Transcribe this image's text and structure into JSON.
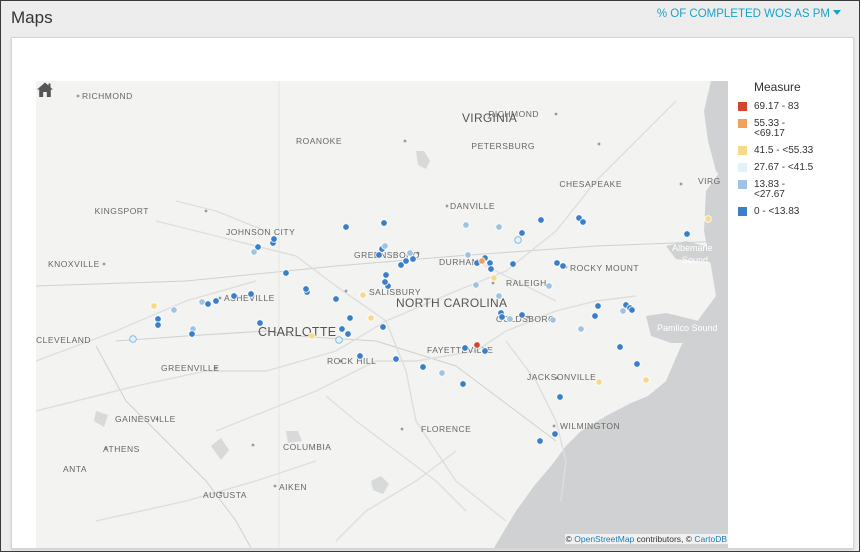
{
  "header": {
    "title": "Maps",
    "measure_dropdown": "% OF COMPLETED WOS AS PM"
  },
  "legend": {
    "title": "Measure",
    "items": [
      {
        "label": "69.17 - 83",
        "color": "#d2452f"
      },
      {
        "label": "55.33 - <69.17",
        "color": "#f2a05e"
      },
      {
        "label": "41.5 - <55.33",
        "color": "#f7d98b"
      },
      {
        "label": "27.67 - <41.5",
        "color": "#e3f1fa"
      },
      {
        "label": "13.83 - <27.67",
        "color": "#9ec3e3"
      },
      {
        "label": "0 - <13.83",
        "color": "#3a7fc8"
      }
    ]
  },
  "map": {
    "state_labels": [
      "VIRGINIA",
      "NORTH CAROLINA"
    ],
    "big_city_labels": [
      "CHARLOTTE"
    ],
    "city_labels": [
      "RICHMOND",
      "RICHMOND",
      "ROANOKE",
      "PETERSBURG",
      "CHESAPEAKE",
      "VIRG",
      "KINGSPORT",
      "JOHNSON CITY",
      "DANVILLE",
      "KNOXVILLE",
      "GREENSBORO",
      "DURHAM",
      "ROCKY MOUNT",
      "RALEIGH",
      "ASHEVILLE",
      "SALISBURY",
      "GOLDSBORO",
      "CLEVELAND",
      "FAYETTEVILLE",
      "ROCK HILL",
      "GREENVILLE",
      "JACKSONVILLE",
      "GAINESVILLE",
      "WILMINGTON",
      "ATHENS",
      "COLUMBIA",
      "FLORENCE",
      "ANTA",
      "AUGUSTA",
      "AIKEN"
    ],
    "water_labels": [
      "Albemarle Sound",
      "Pamlico Sound"
    ],
    "home_icon": "home-icon"
  },
  "attribution": {
    "prefix": "© ",
    "osm": "OpenStreetMap",
    "middle": " contributors, © ",
    "carto": "CartoDB"
  }
}
